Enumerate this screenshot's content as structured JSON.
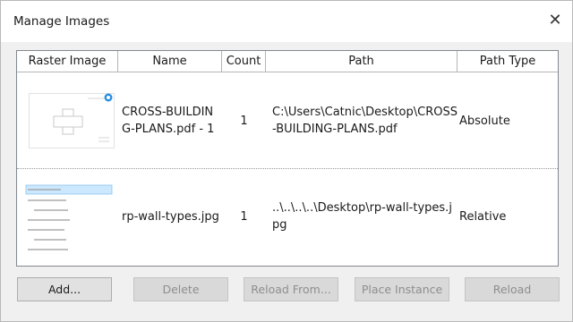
{
  "dialog": {
    "title": "Manage Images",
    "close_glyph": "✕"
  },
  "table": {
    "headers": [
      "Raster Image",
      "Name",
      "Count",
      "Path",
      "Path Type"
    ],
    "rows": [
      {
        "thumbnail_icon": "floor-plan-thumbnail",
        "name": "CROSS-BUILDING-PLANS.pdf - 1",
        "count": "1",
        "path": "C:\\Users\\Catnic\\Desktop\\CROSS-BUILDING-PLANS.pdf",
        "path_type": "Absolute"
      },
      {
        "thumbnail_icon": "wall-types-list-thumbnail",
        "name": "rp-wall-types.jpg",
        "count": "1",
        "path": "..\\..\\..\\..\\Desktop\\rp-wall-types.jpg",
        "path_type": "Relative"
      }
    ]
  },
  "buttons": {
    "add": "Add...",
    "delete": "Delete",
    "reload_from": "Reload From...",
    "place_instance": "Place Instance",
    "reload": "Reload"
  },
  "colors": {
    "dialog_bg": "#f0f0f0",
    "selection_blue": "#cce8ff",
    "badge_blue": "#1e90ff"
  }
}
